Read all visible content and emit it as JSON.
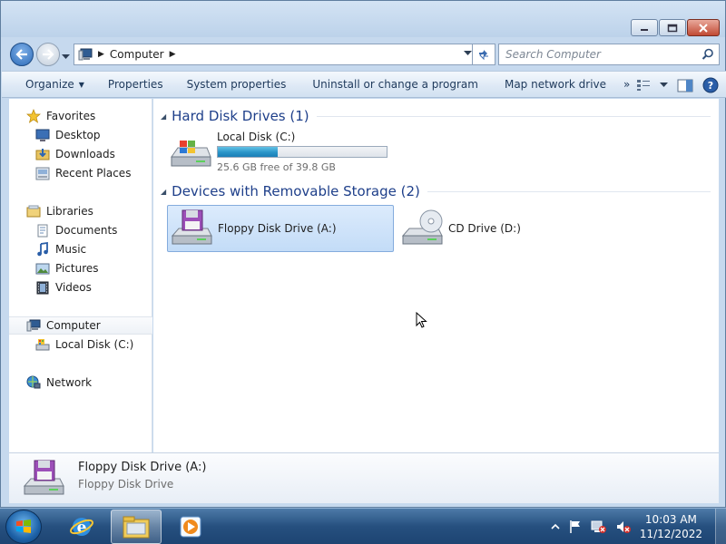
{
  "window": {
    "address": {
      "crumbs": [
        "Computer"
      ],
      "icon": "computer-icon"
    },
    "search": {
      "placeholder": "Search Computer"
    },
    "controls": [
      "minimize-icon",
      "maximize-icon",
      "close-icon"
    ]
  },
  "toolbar": {
    "organize": "Organize",
    "properties": "Properties",
    "system_properties": "System properties",
    "uninstall": "Uninstall or change a program",
    "map_drive": "Map network drive",
    "more": "»"
  },
  "sidebar": {
    "favorites": "Favorites",
    "desktop": "Desktop",
    "downloads": "Downloads",
    "recent": "Recent Places",
    "libraries": "Libraries",
    "documents": "Documents",
    "music": "Music",
    "pictures": "Pictures",
    "videos": "Videos",
    "computer": "Computer",
    "local_disk": "Local Disk (C:)",
    "network": "Network"
  },
  "main": {
    "hdd_group": "Hard Disk Drives (1)",
    "removable_group": "Devices with Removable Storage (2)",
    "drives": {
      "c": {
        "name": "Local Disk (C:)",
        "free_text": "25.6 GB free of 39.8 GB",
        "used_fraction": 0.357
      },
      "a": {
        "name": "Floppy Disk Drive (A:)"
      },
      "d": {
        "name": "CD Drive (D:)"
      }
    }
  },
  "details": {
    "title": "Floppy Disk Drive (A:)",
    "subtitle": "Floppy Disk Drive"
  },
  "taskbar": {
    "time": "10:03 AM",
    "date": "11/12/2022",
    "apps": [
      "internet-explorer-icon",
      "windows-explorer-icon",
      "media-player-icon"
    ]
  },
  "colors": {
    "accent": "#1e3f8a",
    "capacity_fill": "#2a94c8"
  }
}
